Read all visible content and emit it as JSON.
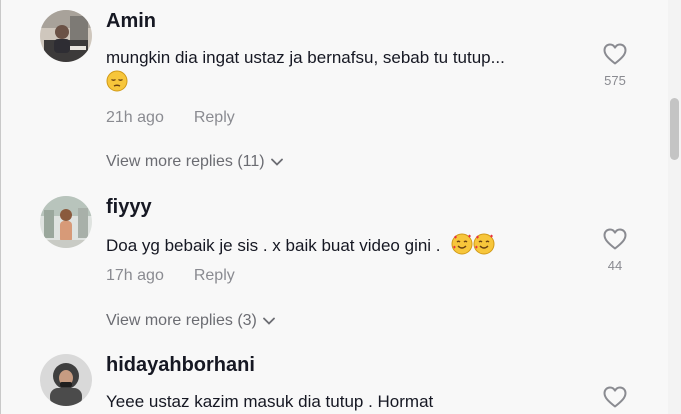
{
  "comments": [
    {
      "username": "Amin",
      "text": "mungkin dia ingat ustaz ja bernafsu, sebab tu tutup...",
      "emoji": [
        "pensive-face"
      ],
      "time": "21h ago",
      "reply_label": "Reply",
      "likes": "575",
      "view_more": "View more replies (11)"
    },
    {
      "username": "fiyyy",
      "text": "Doa yg bebaik je sis . x baik buat video gini .",
      "emoji": [
        "smiling-face-with-hearts",
        "smiling-face-with-hearts"
      ],
      "time": "17h ago",
      "reply_label": "Reply",
      "likes": "44",
      "view_more": "View more replies (3)"
    },
    {
      "username": "hidayahborhani",
      "text": "Yeee ustaz kazim masuk dia tutup . Hormat"
    }
  ],
  "colors": {
    "text_primary": "#161823",
    "text_secondary": "#8a8b91",
    "background": "#f8f8f8"
  }
}
